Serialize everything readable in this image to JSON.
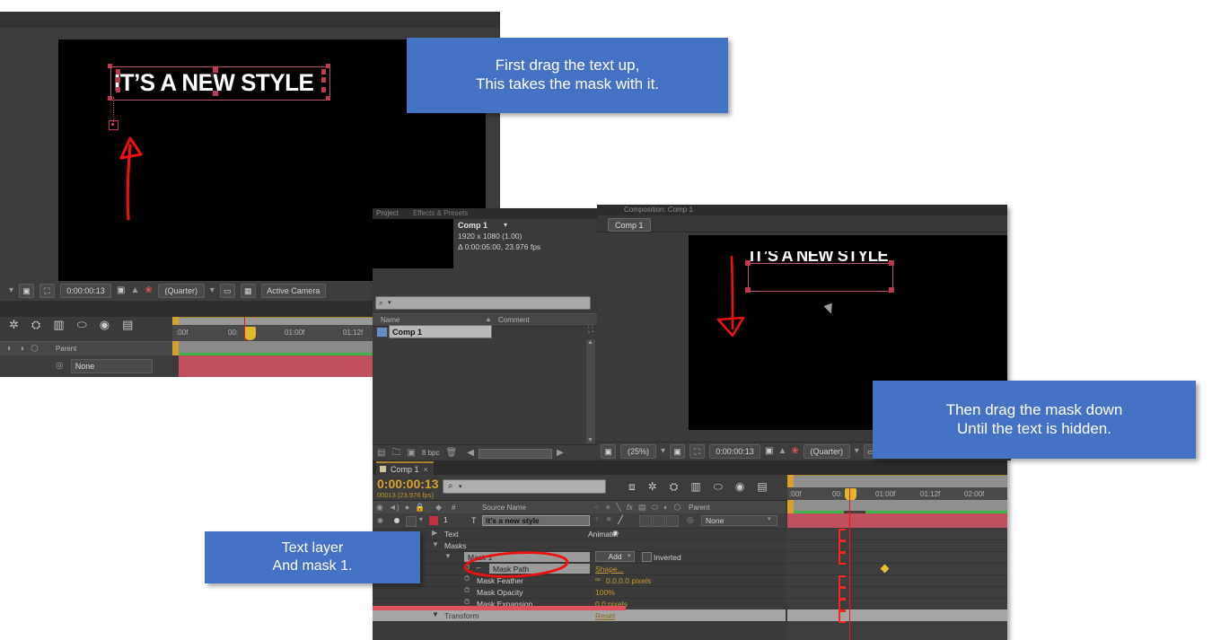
{
  "app": "Adobe After Effects",
  "callouts": [
    {
      "id": "callout-1",
      "line1": "First drag the text up,",
      "line2": "This takes the mask with it."
    },
    {
      "id": "callout-2",
      "line1": "Then drag the mask down",
      "line2": "Until the text is hidden."
    },
    {
      "id": "callout-3",
      "line1": "Text layer",
      "line2": "And mask 1."
    }
  ],
  "callout_color": "#4472c4",
  "shot1": {
    "comp_text": "IT’S A NEW STYLE",
    "viewer_bar": {
      "timecode": "0:00:00:13",
      "resolution": "(Quarter)",
      "view": "Active Camera"
    },
    "timeline": {
      "ruler_labels": [
        ":00f",
        "00:",
        "01:00f",
        "01:12f"
      ],
      "parent_header": "Parent",
      "parent_value": "None"
    }
  },
  "shot2": {
    "tabs": [
      "Project",
      "Effects & Presets"
    ],
    "item": {
      "name": "Comp 1",
      "dimensions": "1920 x 1080 (1.00)",
      "duration": "Δ 0:00:05:00, 23.976 fps"
    },
    "search_placeholder": "",
    "columns": [
      "Name",
      "Comment"
    ],
    "rows": [
      {
        "name": "Comp 1"
      }
    ],
    "footer": {
      "bit_depth": "8 bpc"
    }
  },
  "shot3": {
    "tab": "Composition: Comp 1",
    "comp_tab": "Comp 1",
    "comp_text": "IT’S A NEW STYLE",
    "viewer_bar": {
      "zoom": "(25%)",
      "timecode": "0:00:00:13",
      "resolution": "(Quarter)"
    }
  },
  "shot4": {
    "tab": "Comp 1",
    "timecode": "0:00:00:13",
    "frame_info": "00013 (23.976 fps)",
    "columns": {
      "number": "#",
      "source_name": "Source Name",
      "parent": "Parent"
    },
    "layer": {
      "index": "1",
      "name": "it's a new style",
      "parent_value": "None"
    },
    "properties": [
      {
        "label": "Text",
        "value": "Animate:",
        "indent": 1
      },
      {
        "label": "Masks",
        "value": "",
        "indent": 1
      },
      {
        "label": "Mask 1",
        "value": "Add",
        "value2": "Inverted",
        "indent": 2
      },
      {
        "label": "Mask Path",
        "value": "Shape...",
        "indent": 3
      },
      {
        "label": "Mask Feather",
        "value": "0.0,0.0 pixels",
        "indent": 3
      },
      {
        "label": "Mask Opacity",
        "value": "100%",
        "indent": 3
      },
      {
        "label": "Mask Expansion",
        "value": "0.0 pixels",
        "indent": 3
      },
      {
        "label": "Transform",
        "value": "Reset",
        "indent": 2
      }
    ],
    "ruler_labels": [
      ":00f",
      "00:",
      "01:00f",
      "01:12f",
      "02:00f"
    ],
    "keyframe_row": "Mask Path"
  }
}
